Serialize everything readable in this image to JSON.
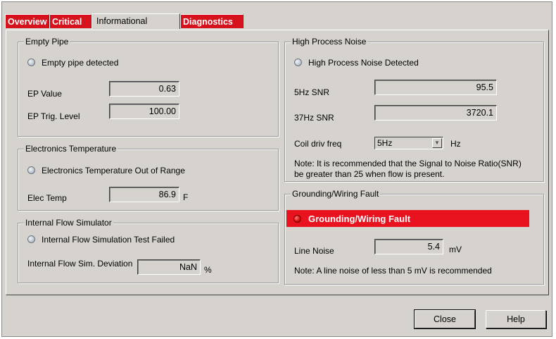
{
  "tabs": [
    {
      "label": "Overview",
      "active": false
    },
    {
      "label": "Critical",
      "active": false
    },
    {
      "label": "Informational",
      "active": true
    },
    {
      "label": "Diagnostics",
      "active": false
    }
  ],
  "empty_pipe": {
    "title": "Empty Pipe",
    "indicator_label": "Empty pipe detected",
    "ep_value_label": "EP Value",
    "ep_value": "0.63",
    "ep_trig_label": "EP Trig. Level",
    "ep_trig_value": "100.00"
  },
  "electronics_temp": {
    "title": "Electronics Temperature",
    "indicator_label": "Electronics Temperature Out of Range",
    "elec_temp_label": "Elec Temp",
    "elec_temp_value": "86.9",
    "elec_temp_unit": "F"
  },
  "flow_simulator": {
    "title": "Internal Flow Simulator",
    "indicator_label": "Internal Flow Simulation Test Failed",
    "deviation_label": "Internal Flow Sim. Deviation",
    "deviation_value": "NaN",
    "deviation_unit": "%"
  },
  "high_noise": {
    "title": "High Process Noise",
    "indicator_label": "High Process Noise Detected",
    "snr5_label": "5Hz SNR",
    "snr5_value": "95.5",
    "snr37_label": "37Hz SNR",
    "snr37_value": "3720.1",
    "coil_label": "Coil driv freq",
    "coil_value": "5Hz",
    "coil_unit": "Hz",
    "note_line1": "Note: It is recommended that the Signal to Noise Ratio(SNR)",
    "note_line2": "be greater than 25 when flow is present."
  },
  "grounding": {
    "title": "Grounding/Wiring Fault",
    "fault_label": "Grounding/Wiring Fault",
    "line_noise_label": "Line Noise",
    "line_noise_value": "5.4",
    "line_noise_unit": "mV",
    "note": "Note: A line noise of less than 5 mV is recommended"
  },
  "buttons": {
    "close": "Close",
    "help": "Help"
  },
  "colors": {
    "alert_red": "#e8131f",
    "tab_red": "#d6121c",
    "dialog_gray": "#d6d3ce"
  }
}
